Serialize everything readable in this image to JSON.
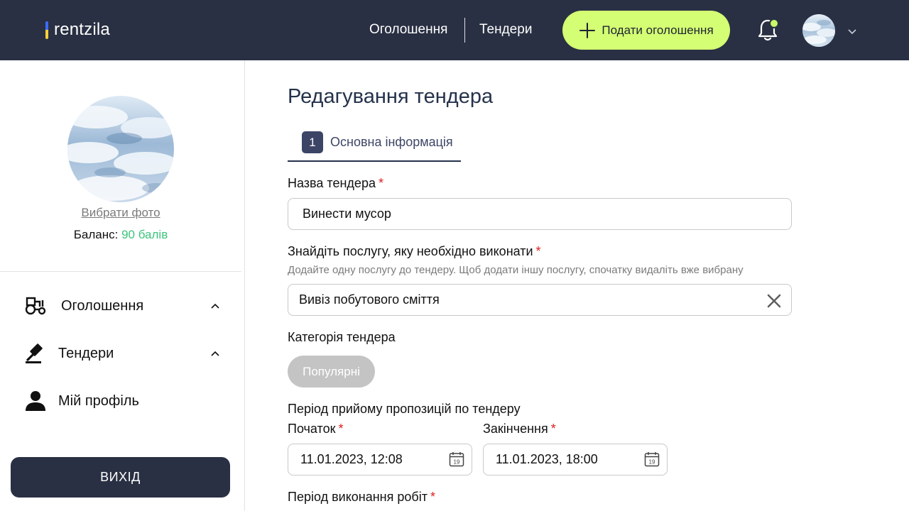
{
  "header": {
    "logo_text": "rentzila",
    "nav": {
      "ads": "Оголошення",
      "tenders": "Тендери"
    },
    "post_button": "Подати оголошення"
  },
  "sidebar": {
    "choose_photo": "Вибрати фото",
    "balance_label": "Баланс:",
    "balance_value": "90 балів",
    "menu": {
      "ads": "Оголошення",
      "tenders": "Тендери",
      "profile": "Мій профіль"
    },
    "logout": "ВИХІД"
  },
  "main": {
    "title": "Редагування тендера",
    "tab": {
      "number": "1",
      "label": "Основна інформація"
    },
    "tender_name": {
      "label": "Назва тендера",
      "required": "*",
      "value": "Винести мусор"
    },
    "service": {
      "label": "Знайдіть послугу, яку необхідно виконати",
      "required": "*",
      "hint": "Додайте одну послугу до тендеру. Щоб додати іншу послугу, спочатку видаліть вже вибрану",
      "value": "Вивіз побутового сміття"
    },
    "category": {
      "label": "Категорія тендера",
      "chip": "Популярні"
    },
    "period": {
      "label": "Період прийому пропозицій по тендеру",
      "start_label": "Початок",
      "end_label": "Закінчення",
      "required": "*",
      "start_value": "11.01.2023, 12:08",
      "end_value": "11.01.2023, 18:00",
      "calendar_day": "19"
    },
    "work_period": {
      "label": "Період виконання робіт",
      "required": "*"
    }
  },
  "colors": {
    "header_bg": "#293043",
    "accent_green": "#d4fe73",
    "points_green": "#3cc47c",
    "required_red": "#e11d1d",
    "chip_gray": "#c4c4c4"
  },
  "icons": [
    "plus-icon",
    "bell-icon",
    "chevron-down-icon",
    "tractor-icon",
    "gavel-icon",
    "person-icon",
    "chevron-up-icon",
    "close-icon",
    "calendar-icon"
  ]
}
